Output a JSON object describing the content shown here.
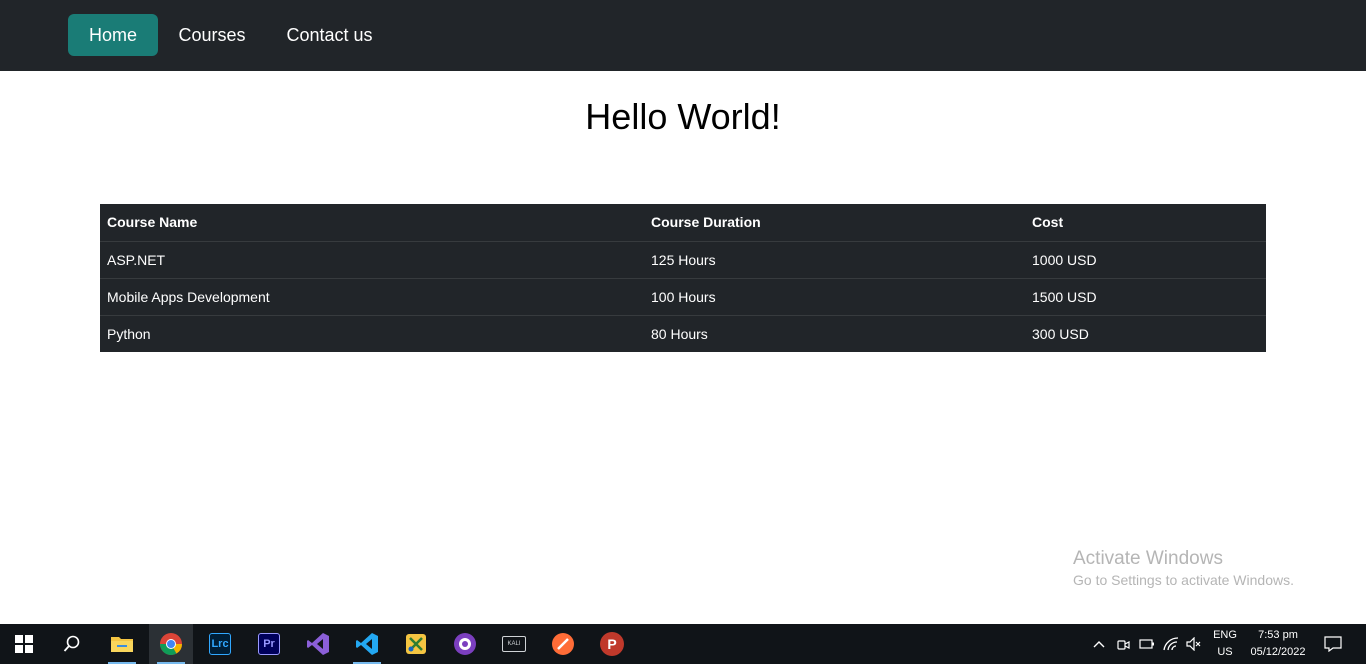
{
  "nav": {
    "items": [
      {
        "label": "Home",
        "active": true
      },
      {
        "label": "Courses",
        "active": false
      },
      {
        "label": "Contact us",
        "active": false
      }
    ],
    "active_color": "#1a7c76",
    "bg_color": "#212529"
  },
  "main": {
    "heading": "Hello World!"
  },
  "table": {
    "headers": [
      "Course Name",
      "Course Duration",
      "Cost"
    ],
    "rows": [
      [
        "ASP.NET",
        "125 Hours",
        "1000 USD"
      ],
      [
        "Mobile Apps Development",
        "100 Hours",
        "1500 USD"
      ],
      [
        "Python",
        "80 Hours",
        "300 USD"
      ]
    ]
  },
  "watermark": {
    "title": "Activate Windows",
    "subtitle": "Go to Settings to activate Windows."
  },
  "taskbar": {
    "apps": [
      {
        "name": "windows-start-icon"
      },
      {
        "name": "search-icon"
      },
      {
        "name": "file-explorer-icon"
      },
      {
        "name": "chrome-icon",
        "active": true
      },
      {
        "name": "lightroom-classic-icon",
        "label": "Lrc"
      },
      {
        "name": "premiere-pro-icon",
        "label": "Pr"
      },
      {
        "name": "visual-studio-icon"
      },
      {
        "name": "vscode-icon",
        "active": true
      },
      {
        "name": "snipping-tool-icon"
      },
      {
        "name": "github-desktop-icon"
      },
      {
        "name": "kali-terminal-icon",
        "label": "KALI"
      },
      {
        "name": "postman-icon"
      },
      {
        "name": "psiphon-icon",
        "label": "P"
      }
    ],
    "tray": {
      "language": "ENG",
      "region": "US",
      "time": "7:53 pm",
      "date": "05/12/2022"
    }
  }
}
